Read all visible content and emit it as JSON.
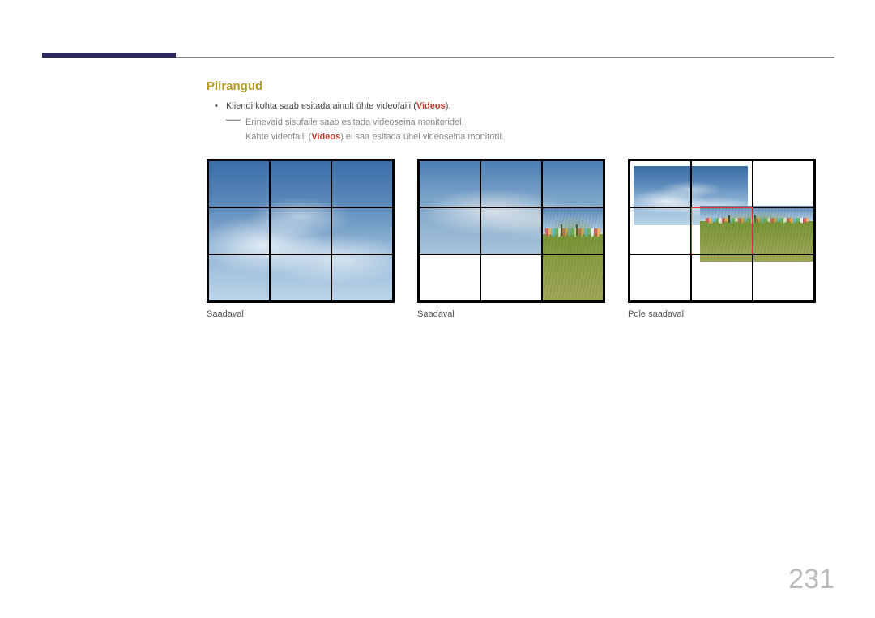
{
  "section_title": "Piirangud",
  "bullet_pre": "Kliendi kohta saab esitada ainult ühte videofaili (",
  "bullet_hl": "Videos",
  "bullet_post": ").",
  "note_line1": "Erinevaid sisufaile saab esitada videoseina monitoridel.",
  "note_line2_pre": "Kahte videofaili (",
  "note_line2_hl": "Videos",
  "note_line2_post": ") ei saa esitada ühel videoseina monitoril.",
  "captions": {
    "a": "Saadaval",
    "b": "Saadaval",
    "c": "Pole saadaval"
  },
  "page_number": "231"
}
